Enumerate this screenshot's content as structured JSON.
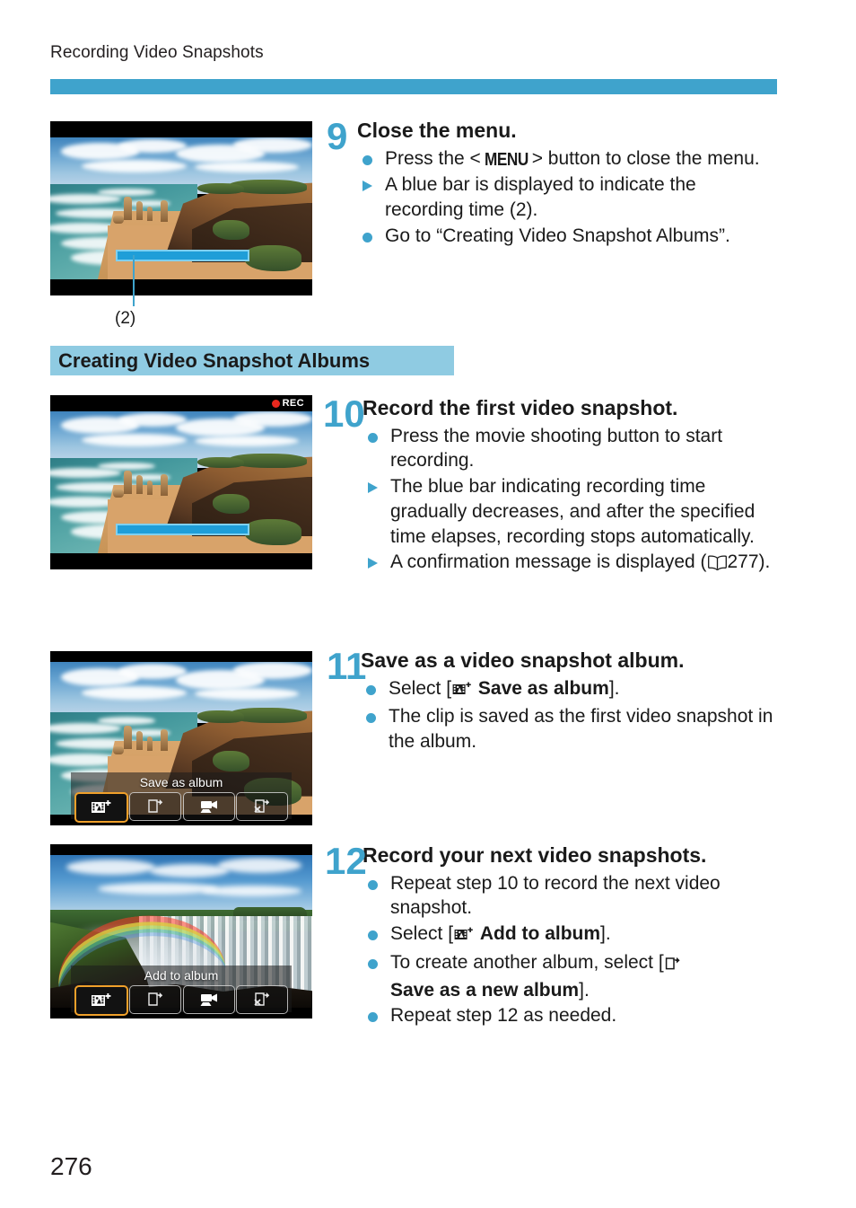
{
  "header": {
    "running_title": "Recording Video Snapshots",
    "rule_color": "#3fa3cc"
  },
  "section": {
    "band_title": "Creating Video Snapshot Albums",
    "band_color": "#8fcbe2"
  },
  "page_number": "276",
  "steps": [
    {
      "number": "9",
      "title": "Close the menu.",
      "bullets": [
        {
          "marker": "dot",
          "text_before": "Press the <",
          "icon": "MENU",
          "text_after": "> button to close the menu."
        },
        {
          "marker": "triangle",
          "text": "A blue bar is displayed to indicate the recording time (2)."
        },
        {
          "marker": "dot",
          "text": "Go to “Creating Video Snapshot Albums”."
        }
      ],
      "figure": {
        "scene": "coastal-twelve-apostles",
        "recording_bar": true,
        "rec_indicator": false,
        "callout_label": "(2)"
      }
    },
    {
      "number": "10",
      "title": "Record the first video snapshot.",
      "bullets": [
        {
          "marker": "dot",
          "text": "Press the movie shooting button to start recording."
        },
        {
          "marker": "triangle",
          "text": "The blue bar indicating recording time gradually decreases, and after the specified time elapses, recording stops automatically."
        },
        {
          "marker": "triangle",
          "text_before": "A confirmation message is displayed (",
          "icon": "book",
          "text_after": "277)."
        }
      ],
      "figure": {
        "scene": "coastal-twelve-apostles",
        "recording_bar": true,
        "rec_indicator": true,
        "rec_label": "REC"
      }
    },
    {
      "number": "11",
      "title": "Save as a video snapshot album.",
      "bullets": [
        {
          "marker": "dot",
          "text_before": "Select [",
          "icon": "album-add",
          "bold_text": "Save as album",
          "text_after": "]."
        },
        {
          "marker": "dot",
          "text": "The clip is saved as the first video snapshot in the album."
        }
      ],
      "figure": {
        "scene": "coastal-twelve-apostles",
        "menu_caption": "Save as album",
        "menu_buttons": [
          {
            "icon": "save-as-album-icon",
            "selected": true
          },
          {
            "icon": "save-as-new-album-icon",
            "selected": false
          },
          {
            "icon": "playback-movie-icon",
            "selected": false
          },
          {
            "icon": "delete-clip-icon",
            "selected": false
          }
        ]
      }
    },
    {
      "number": "12",
      "title": "Record your next video snapshots.",
      "bullets": [
        {
          "marker": "dot",
          "text": "Repeat step 10 to record the next video snapshot."
        },
        {
          "marker": "dot",
          "text_before": "Select [",
          "icon": "album-add",
          "bold_text": "Add to album",
          "text_after": "]."
        },
        {
          "marker": "dot",
          "text_before": "To create another album, select [",
          "icon": "new-album",
          "bold_text": "Save as a new album",
          "text_after": "]."
        },
        {
          "marker": "dot",
          "text": "Repeat step 12 as needed."
        }
      ],
      "figure": {
        "scene": "waterfall-rainbow",
        "menu_caption": "Add to album",
        "menu_buttons": [
          {
            "icon": "save-as-album-icon",
            "selected": true
          },
          {
            "icon": "save-as-new-album-icon",
            "selected": false
          },
          {
            "icon": "playback-movie-icon",
            "selected": false
          },
          {
            "icon": "delete-clip-icon",
            "selected": false
          }
        ]
      }
    }
  ],
  "colors": {
    "accent_blue": "#3fa3cc",
    "band_blue": "#8fcbe2",
    "rec_bar_fill": "#1f9ed8",
    "rec_bar_border": "#7fd0f0",
    "rec_red": "#e8281e",
    "selection_orange": "#f0a02a"
  }
}
